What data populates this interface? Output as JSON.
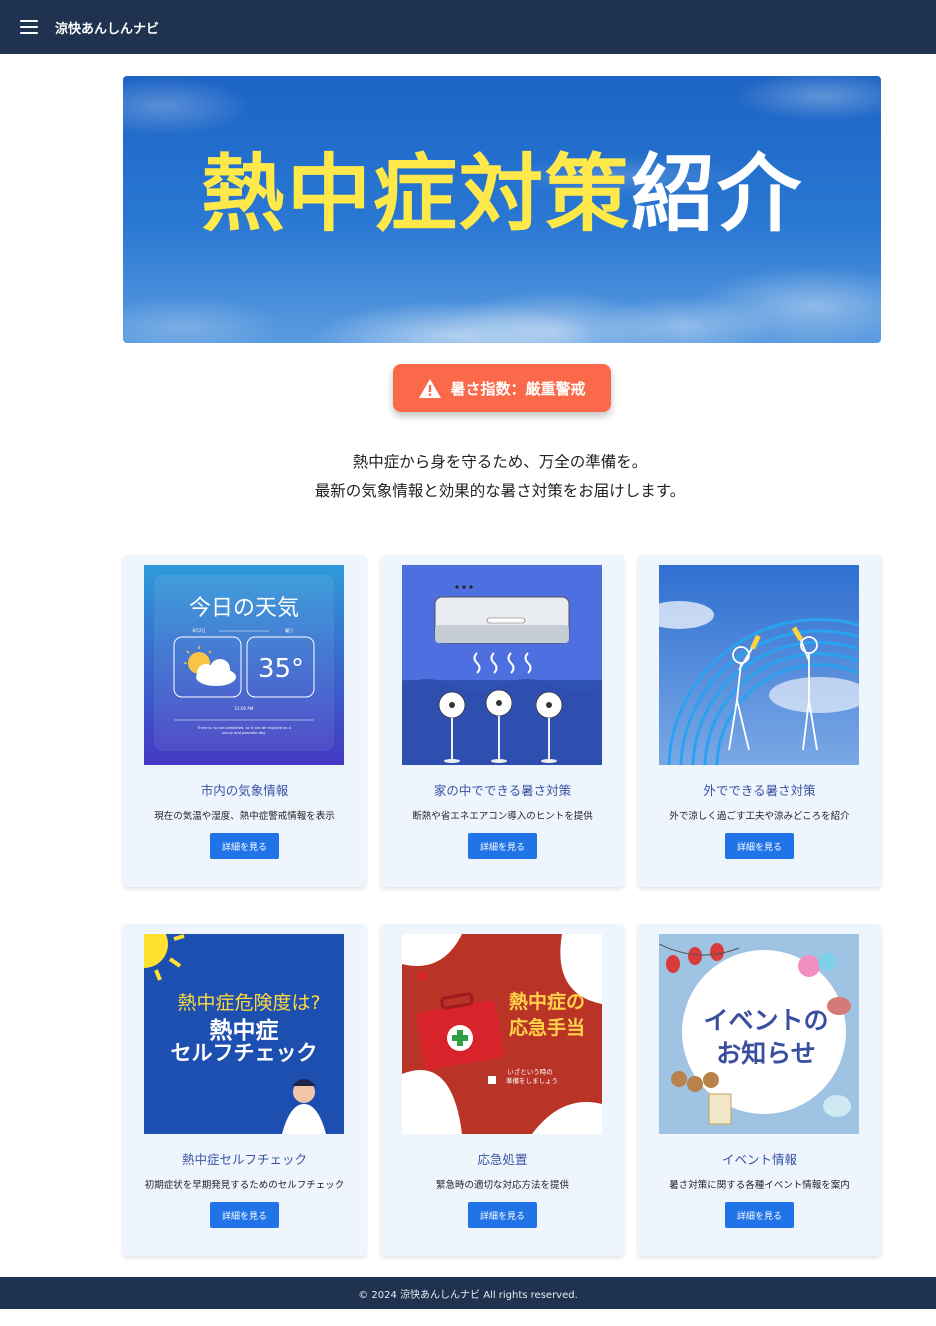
{
  "appbar": {
    "title": "涼快あんしんナビ"
  },
  "hero": {
    "title_yellow": "熱中症対策",
    "title_white": "紹介"
  },
  "alert": {
    "label": "暑さ指数：厳重警戒"
  },
  "intro": {
    "line1": "熱中症から身を守るため、万全の準備を。",
    "line2": "最新の気象情報と効果的な暑さ対策をお届けします。"
  },
  "cards": [
    {
      "title": "市内の気象情報",
      "desc": "現在の気温や湿度、熱中症警戒情報を表示",
      "button": "詳細を見る",
      "image": {
        "heading": "今日の天気",
        "date": "8月2日",
        "day": "曜日",
        "temp": "35°",
        "time": "12:00 AM",
        "note1": "There is no rain predicted, so it can be enjoyed on a",
        "note2": "sunny and peaceful day."
      }
    },
    {
      "title": "家の中でできる暑さ対策",
      "desc": "断熱や省エネエアコン導入のヒントを提供",
      "button": "詳細を見る"
    },
    {
      "title": "外でできる暑さ対策",
      "desc": "外で涼しく過ごす工夫や涼みどころを紹介",
      "button": "詳細を見る"
    },
    {
      "title": "熱中症セルフチェック",
      "desc": "初期症状を早期発見するためのセルフチェック",
      "button": "詳細を見る",
      "image": {
        "line1": "熱中症危険度は?",
        "line2": "熱中症",
        "line3": "セルフチェック"
      }
    },
    {
      "title": "応急処置",
      "desc": "緊急時の適切な対応方法を提供",
      "button": "詳細を見る",
      "image": {
        "line1": "熱中症の",
        "line2": "応急手当",
        "sub1": "いざという時の",
        "sub2": "準備をしましょう"
      }
    },
    {
      "title": "イベント情報",
      "desc": "暑さ対策に関する各種イベント情報を案内",
      "button": "詳細を見る",
      "image": {
        "line1": "イベントの",
        "line2": "お知らせ"
      }
    }
  ],
  "footer": {
    "text": "© 2024 涼快あんしんナビ All rights reserved."
  },
  "colors": {
    "appbar": "#1f3350",
    "hero_sky": "#1c63c5",
    "hero_yellow": "#ffe94a",
    "alert": "#fa6a4a",
    "card_bg": "#eef5fd",
    "button": "#2174e8",
    "card_title": "#3a52a3"
  },
  "icons": {
    "menu": "menu-icon",
    "alert": "warning-icon"
  }
}
